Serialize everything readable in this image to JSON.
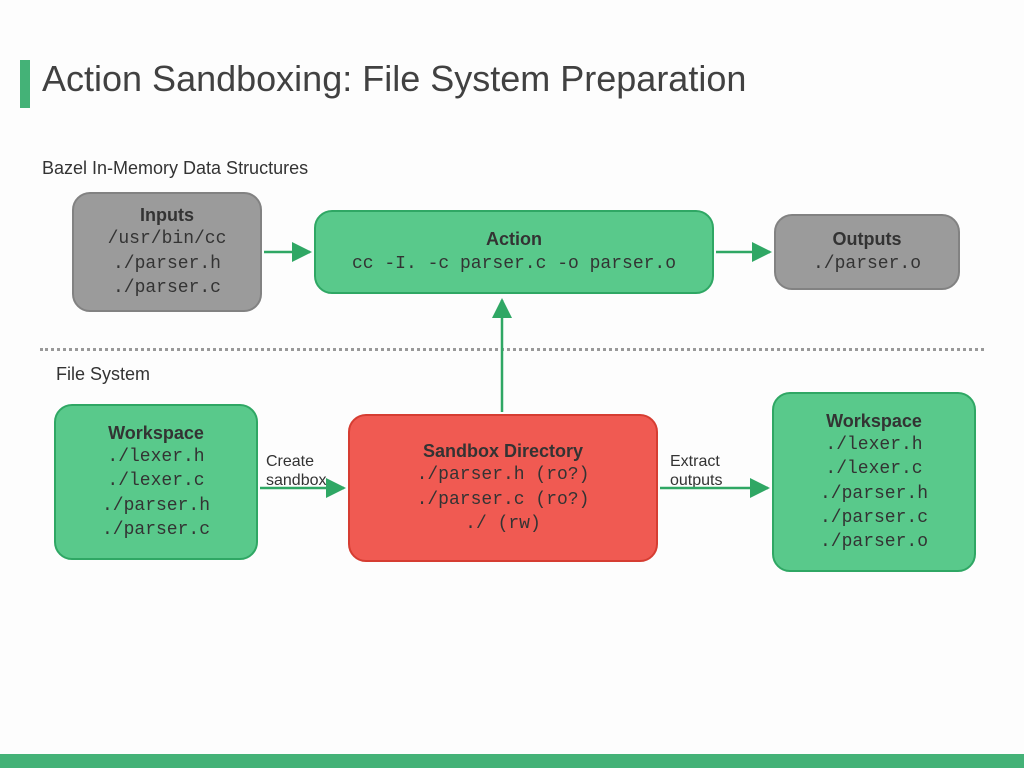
{
  "title": "Action Sandboxing: File System Preparation",
  "sections": {
    "top": "Bazel In-Memory Data Structures",
    "bottom": "File System"
  },
  "boxes": {
    "inputs": {
      "heading": "Inputs",
      "body": "/usr/bin/cc\n./parser.h\n./parser.c"
    },
    "action": {
      "heading": "Action",
      "body": "cc -I. -c parser.c -o parser.o"
    },
    "outputs": {
      "heading": "Outputs",
      "body": "./parser.o"
    },
    "workspace_before": {
      "heading": "Workspace",
      "body": "./lexer.h\n./lexer.c\n./parser.h\n./parser.c"
    },
    "sandbox": {
      "heading": "Sandbox Directory",
      "body": "./parser.h (ro?)\n./parser.c (ro?)\n./ (rw)"
    },
    "workspace_after": {
      "heading": "Workspace",
      "body": "./lexer.h\n./lexer.c\n./parser.h\n./parser.c\n./parser.o"
    }
  },
  "arrows": {
    "create_sandbox": "Create\nsandbox",
    "extract_outputs": "Extract\noutputs"
  },
  "colors": {
    "accent": "#44b277",
    "arrow": "#2fa764"
  },
  "chart_data": {
    "type": "diagram",
    "title": "Action Sandboxing: File System Preparation",
    "nodes": [
      {
        "id": "inputs",
        "label": "Inputs",
        "group": "Bazel In-Memory Data Structures",
        "lines": [
          "/usr/bin/cc",
          "./parser.h",
          "./parser.c"
        ],
        "color": "gray"
      },
      {
        "id": "action",
        "label": "Action",
        "group": "Bazel In-Memory Data Structures",
        "lines": [
          "cc -I. -c parser.c -o parser.o"
        ],
        "color": "green"
      },
      {
        "id": "outputs",
        "label": "Outputs",
        "group": "Bazel In-Memory Data Structures",
        "lines": [
          "./parser.o"
        ],
        "color": "gray"
      },
      {
        "id": "workspace_before",
        "label": "Workspace",
        "group": "File System",
        "lines": [
          "./lexer.h",
          "./lexer.c",
          "./parser.h",
          "./parser.c"
        ],
        "color": "green"
      },
      {
        "id": "sandbox",
        "label": "Sandbox Directory",
        "group": "File System",
        "lines": [
          "./parser.h (ro?)",
          "./parser.c (ro?)",
          "./ (rw)"
        ],
        "color": "red"
      },
      {
        "id": "workspace_after",
        "label": "Workspace",
        "group": "File System",
        "lines": [
          "./lexer.h",
          "./lexer.c",
          "./parser.h",
          "./parser.c",
          "./parser.o"
        ],
        "color": "green"
      }
    ],
    "edges": [
      {
        "from": "inputs",
        "to": "action",
        "label": ""
      },
      {
        "from": "action",
        "to": "outputs",
        "label": ""
      },
      {
        "from": "workspace_before",
        "to": "sandbox",
        "label": "Create sandbox"
      },
      {
        "from": "sandbox",
        "to": "action",
        "label": ""
      },
      {
        "from": "sandbox",
        "to": "workspace_after",
        "label": "Extract outputs"
      }
    ]
  }
}
